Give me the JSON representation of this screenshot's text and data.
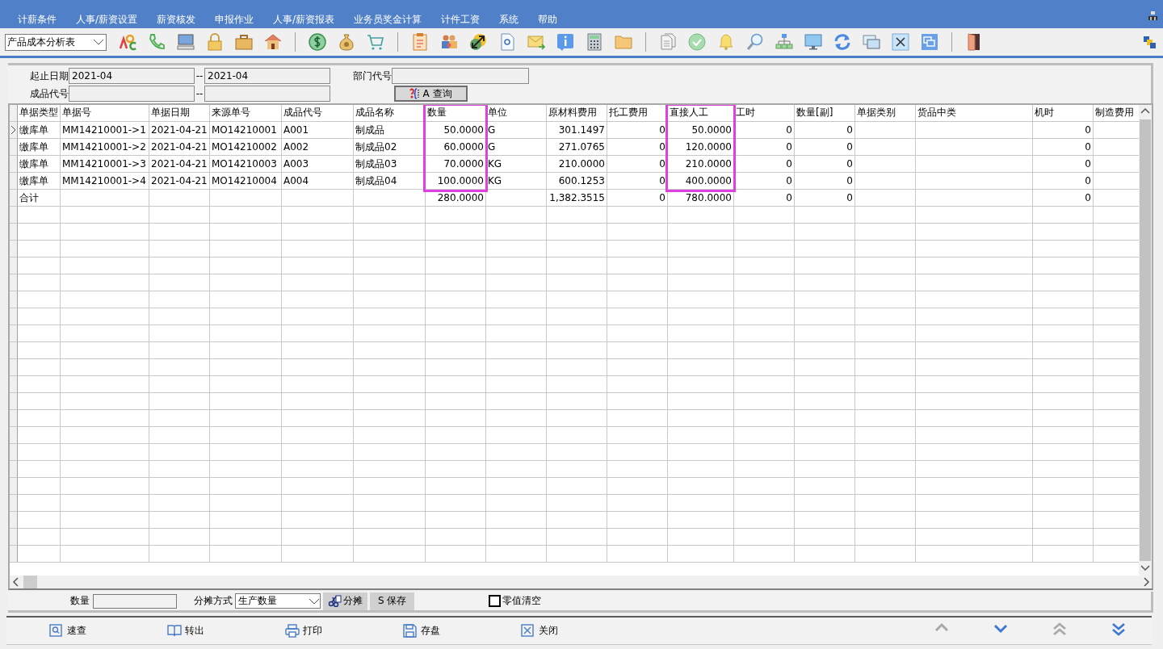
{
  "menu": [
    "计薪条件",
    "人事/薪资设置",
    "薪资核发",
    "申报作业",
    "人事/薪资报表",
    "业务员奖金计算",
    "计件工资",
    "系统",
    "帮助"
  ],
  "toolbar": {
    "report_select": "产品成本分析表"
  },
  "filter": {
    "date_label": "起止日期",
    "date_from": "2021-04",
    "date_sep": "--",
    "date_to": "2021-04",
    "dept_label": "部门代号",
    "product_label": "成品代号",
    "product_sep": "--",
    "query_button": "A 查询"
  },
  "table": {
    "columns": [
      {
        "label": "单据类型",
        "kind": "text",
        "highlighted": false
      },
      {
        "label": "单据号",
        "kind": "text",
        "highlighted": false
      },
      {
        "label": "单据日期",
        "kind": "text",
        "highlighted": false
      },
      {
        "label": "来源单号",
        "kind": "text",
        "highlighted": false
      },
      {
        "label": "成品代号",
        "kind": "text",
        "highlighted": false
      },
      {
        "label": "成品名称",
        "kind": "text",
        "highlighted": false
      },
      {
        "label": "数量",
        "kind": "number",
        "highlighted": true
      },
      {
        "label": "单位",
        "kind": "text",
        "highlighted": false
      },
      {
        "label": "原材料费用",
        "kind": "number",
        "highlighted": false
      },
      {
        "label": "托工费用",
        "kind": "number",
        "highlighted": false
      },
      {
        "label": "直接人工",
        "kind": "number",
        "highlighted": true
      },
      {
        "label": "工时",
        "kind": "number",
        "highlighted": false
      },
      {
        "label": "数量[副]",
        "kind": "number",
        "highlighted": false
      },
      {
        "label": "单据类别",
        "kind": "text",
        "highlighted": false
      },
      {
        "label": "货品中类",
        "kind": "text",
        "highlighted": false
      },
      {
        "label": "机时",
        "kind": "number",
        "highlighted": false
      },
      {
        "label": "制造费用",
        "kind": "number",
        "highlighted": false
      }
    ],
    "rows": [
      {
        "kind": "data",
        "current": true,
        "cells": [
          "缴库单",
          "MM14210001->1",
          "2021-04-21",
          "MO14210001",
          "A001",
          "制成品",
          "50.0000",
          "G",
          "301.1497",
          "0",
          "50.0000",
          "0",
          "0",
          null,
          null,
          "0",
          null
        ]
      },
      {
        "kind": "data",
        "current": false,
        "cells": [
          "缴库单",
          "MM14210001->2",
          "2021-04-21",
          "MO14210002",
          "A002",
          "制成品02",
          "60.0000",
          "G",
          "271.0765",
          "0",
          "120.0000",
          "0",
          "0",
          null,
          null,
          "0",
          null
        ]
      },
      {
        "kind": "data",
        "current": false,
        "cells": [
          "缴库单",
          "MM14210001->3",
          "2021-04-21",
          "MO14210003",
          "A003",
          "制成品03",
          "70.0000",
          "KG",
          "210.0000",
          "0",
          "210.0000",
          "0",
          "0",
          null,
          null,
          "0",
          null
        ]
      },
      {
        "kind": "data",
        "current": false,
        "cells": [
          "缴库单",
          "MM14210001->4",
          "2021-04-21",
          "MO14210004",
          "A004",
          "制成品04",
          "100.0000",
          "KG",
          "600.1253",
          "0",
          "400.0000",
          "0",
          "0",
          null,
          null,
          "0",
          null
        ]
      },
      {
        "kind": "total",
        "current": false,
        "cells": [
          "合计",
          null,
          null,
          null,
          null,
          null,
          "280.0000",
          null,
          "1,382.3515",
          "0",
          "780.0000",
          "0",
          "0",
          null,
          null,
          "0",
          null
        ]
      }
    ]
  },
  "allocation": {
    "qty_label": "数量",
    "method_label": "分摊方式",
    "method_value": "生产数量",
    "allocate_button": "分摊",
    "save_button": "S 保存",
    "zero_clear": {
      "label": "零值清空",
      "checked": false
    }
  },
  "nav": {
    "buttons": [
      {
        "label": "速查",
        "kind": "search"
      },
      {
        "label": "转出",
        "kind": "book"
      },
      {
        "label": "打印",
        "kind": "print"
      },
      {
        "label": "存盘",
        "kind": "save"
      },
      {
        "label": "关闭",
        "kind": "close"
      }
    ],
    "arrows": [
      {
        "kind": "up",
        "disabled": true
      },
      {
        "kind": "down",
        "disabled": false
      },
      {
        "kind": "top",
        "disabled": true
      },
      {
        "kind": "bottom",
        "disabled": false
      }
    ]
  }
}
